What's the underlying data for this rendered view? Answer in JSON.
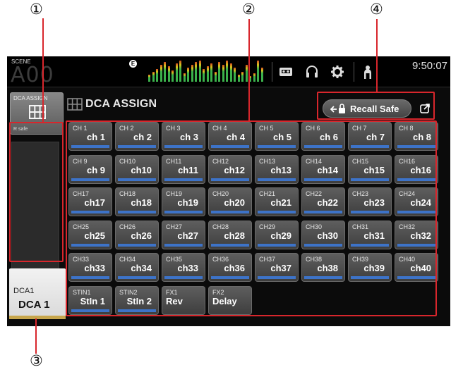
{
  "callouts": {
    "c1": "①",
    "c2": "②",
    "c3": "③",
    "c4": "④"
  },
  "status_bar": {
    "scene_label": "SCENE",
    "scene_value": "A00",
    "e_badge": "E",
    "clock": "9:50:07",
    "icons": [
      "meter-bridge-icon",
      "recorder-icon",
      "headphones-icon",
      "settings-gear-icon",
      "user-icon"
    ]
  },
  "left_panel": {
    "assign_tile": {
      "title": "DCA ASSIGN",
      "sub": "R safe",
      "icon": "grid-icon"
    },
    "dca_strip": {
      "name": "DCA1",
      "value": "DCA 1"
    }
  },
  "header": {
    "title": "DCA ASSIGN",
    "recall_safe_label": "Recall Safe",
    "recall_safe_icon": "lock-arrow-icon",
    "popup_icon": "popup-icon"
  },
  "channels": [
    {
      "num": "CH 1",
      "name": "ch 1"
    },
    {
      "num": "CH 2",
      "name": "ch 2"
    },
    {
      "num": "CH 3",
      "name": "ch 3"
    },
    {
      "num": "CH 4",
      "name": "ch 4"
    },
    {
      "num": "CH 5",
      "name": "ch 5"
    },
    {
      "num": "CH 6",
      "name": "ch 6"
    },
    {
      "num": "CH 7",
      "name": "ch 7"
    },
    {
      "num": "CH 8",
      "name": "ch 8"
    },
    {
      "num": "CH 9",
      "name": "ch 9"
    },
    {
      "num": "CH10",
      "name": "ch10"
    },
    {
      "num": "CH11",
      "name": "ch11"
    },
    {
      "num": "CH12",
      "name": "ch12"
    },
    {
      "num": "CH13",
      "name": "ch13"
    },
    {
      "num": "CH14",
      "name": "ch14"
    },
    {
      "num": "CH15",
      "name": "ch15"
    },
    {
      "num": "CH16",
      "name": "ch16"
    },
    {
      "num": "CH17",
      "name": "ch17"
    },
    {
      "num": "CH18",
      "name": "ch18"
    },
    {
      "num": "CH19",
      "name": "ch19"
    },
    {
      "num": "CH20",
      "name": "ch20"
    },
    {
      "num": "CH21",
      "name": "ch21"
    },
    {
      "num": "CH22",
      "name": "ch22"
    },
    {
      "num": "CH23",
      "name": "ch23"
    },
    {
      "num": "CH24",
      "name": "ch24"
    },
    {
      "num": "CH25",
      "name": "ch25"
    },
    {
      "num": "CH26",
      "name": "ch26"
    },
    {
      "num": "CH27",
      "name": "ch27"
    },
    {
      "num": "CH28",
      "name": "ch28"
    },
    {
      "num": "CH29",
      "name": "ch29"
    },
    {
      "num": "CH30",
      "name": "ch30"
    },
    {
      "num": "CH31",
      "name": "ch31"
    },
    {
      "num": "CH32",
      "name": "ch32"
    },
    {
      "num": "CH33",
      "name": "ch33"
    },
    {
      "num": "CH34",
      "name": "ch34"
    },
    {
      "num": "CH35",
      "name": "ch33"
    },
    {
      "num": "CH36",
      "name": "ch36"
    },
    {
      "num": "CH37",
      "name": "ch37"
    },
    {
      "num": "CH38",
      "name": "ch38"
    },
    {
      "num": "CH39",
      "name": "ch39"
    },
    {
      "num": "CH40",
      "name": "ch40"
    },
    {
      "num": "STIN1",
      "name": "StIn 1"
    },
    {
      "num": "STIN2",
      "name": "StIn 2"
    },
    {
      "num": "FX1",
      "name": "Rev",
      "fx": true
    },
    {
      "num": "FX2",
      "name": "Delay",
      "fx": true
    }
  ],
  "colors": {
    "assign_bar": "#3d73c8",
    "dca_strip_bar": "#c7a64c",
    "callout_red": "#d8262c"
  }
}
